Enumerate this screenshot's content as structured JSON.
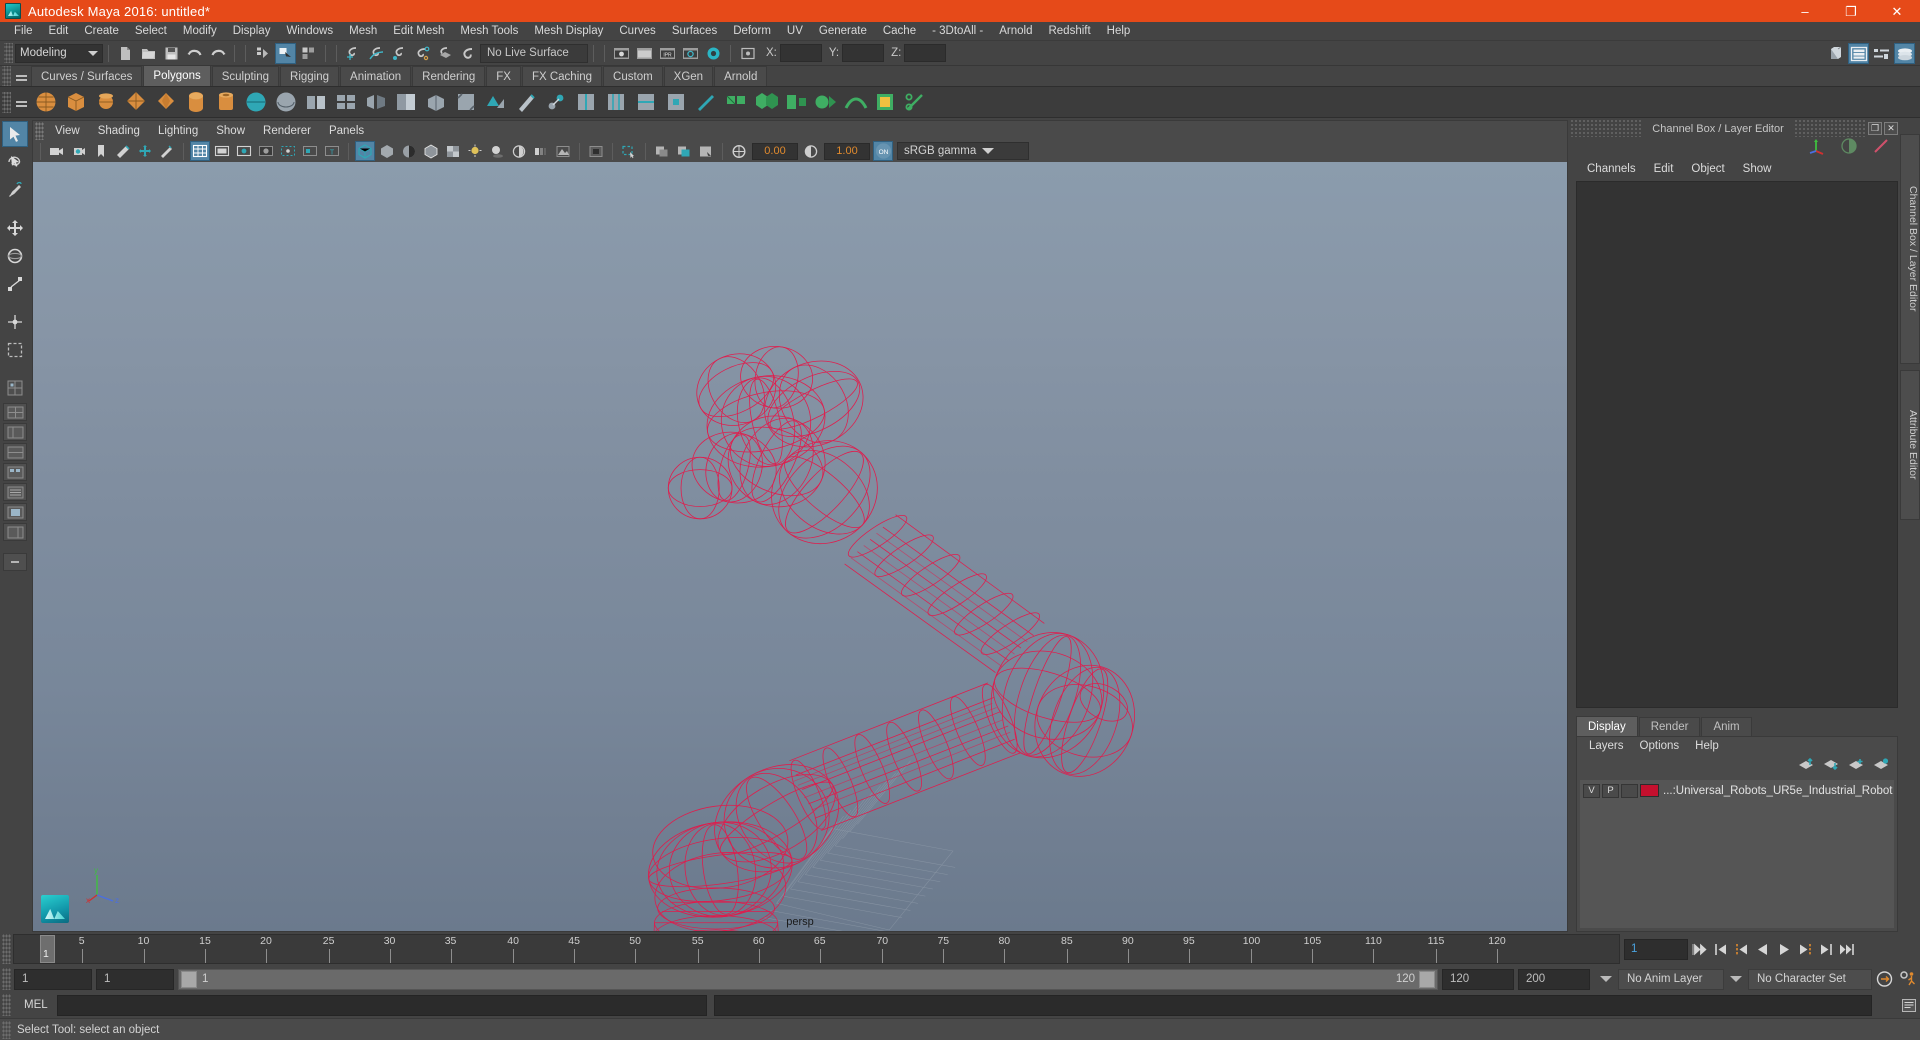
{
  "titlebar": {
    "app_title": "Autodesk Maya 2016: untitled*",
    "minimize": "–",
    "maximize": "❐",
    "close": "✕",
    "accent_color": "#e64a19"
  },
  "menubar": {
    "items": [
      "File",
      "Edit",
      "Create",
      "Select",
      "Modify",
      "Display",
      "Windows",
      "Mesh",
      "Edit Mesh",
      "Mesh Tools",
      "Mesh Display",
      "Curves",
      "Surfaces",
      "Deform",
      "UV",
      "Generate",
      "Cache",
      "- 3DtoAll -",
      "Arnold",
      "Redshift",
      "Help"
    ]
  },
  "statusline": {
    "menuset": "Modeling",
    "live_surface": "No Live Surface",
    "coord_x_label": "X:",
    "coord_y_label": "Y:",
    "coord_z_label": "Z:",
    "coord_x_value": "",
    "coord_y_value": "",
    "coord_z_value": ""
  },
  "shelf": {
    "tabs": [
      "Curves / Surfaces",
      "Polygons",
      "Sculpting",
      "Rigging",
      "Animation",
      "Rendering",
      "FX",
      "FX Caching",
      "Custom",
      "XGen",
      "Arnold"
    ],
    "active_tab": "Polygons"
  },
  "viewport": {
    "menus": [
      "View",
      "Shading",
      "Lighting",
      "Show",
      "Renderer",
      "Panels"
    ],
    "exposure_value": "0.00",
    "gamma_value": "1.00",
    "color_management": "sRGB gamma",
    "view_label": "persp",
    "axis_x": "x",
    "axis_y": "y",
    "axis_z": "z",
    "model_color": "#e3194a",
    "background_top": "#8b9cad",
    "background_bottom": "#6b7a8d"
  },
  "channel_box": {
    "panel_title": "Channel Box / Layer Editor",
    "menus": [
      "Channels",
      "Edit",
      "Object",
      "Show"
    ],
    "restore_glyph": "❐",
    "close_glyph": "✕",
    "side_tabs": [
      "Channel Box / Layer Editor",
      "Attribute Editor"
    ]
  },
  "layer_editor": {
    "tabs": [
      "Display",
      "Render",
      "Anim"
    ],
    "active_tab": "Display",
    "menus": [
      "Layers",
      "Options",
      "Help"
    ],
    "layers": [
      {
        "visibility": "V",
        "playback": "P",
        "state": "",
        "color": "#c4102e",
        "name": "...:Universal_Robots_UR5e_Industrial_Robot"
      }
    ]
  },
  "timeline": {
    "tick_labels": [
      "5",
      "10",
      "15",
      "20",
      "25",
      "30",
      "35",
      "40",
      "45",
      "50",
      "55",
      "60",
      "65",
      "70",
      "75",
      "80",
      "85",
      "90",
      "95",
      "100",
      "105",
      "110",
      "115",
      "120"
    ],
    "current_frame": "1",
    "end_marker": "120",
    "current_frame_field": "1",
    "playback_buttons": [
      "go-to-start",
      "step-back-key",
      "step-back-frame",
      "play-backwards",
      "play-forwards",
      "step-forward-frame",
      "step-forward-key",
      "go-to-end"
    ]
  },
  "range_slider": {
    "start_field": "1",
    "range_start_field": "1",
    "slider_start_label": "1",
    "slider_end_label": "120",
    "range_end_field": "120",
    "end_field": "200",
    "anim_layer": "No Anim Layer",
    "character_set": "No Character Set"
  },
  "command_line": {
    "language_label": "MEL",
    "input_value": "",
    "output_value": ""
  },
  "help_line": {
    "status_text": "Select Tool: select an object"
  }
}
